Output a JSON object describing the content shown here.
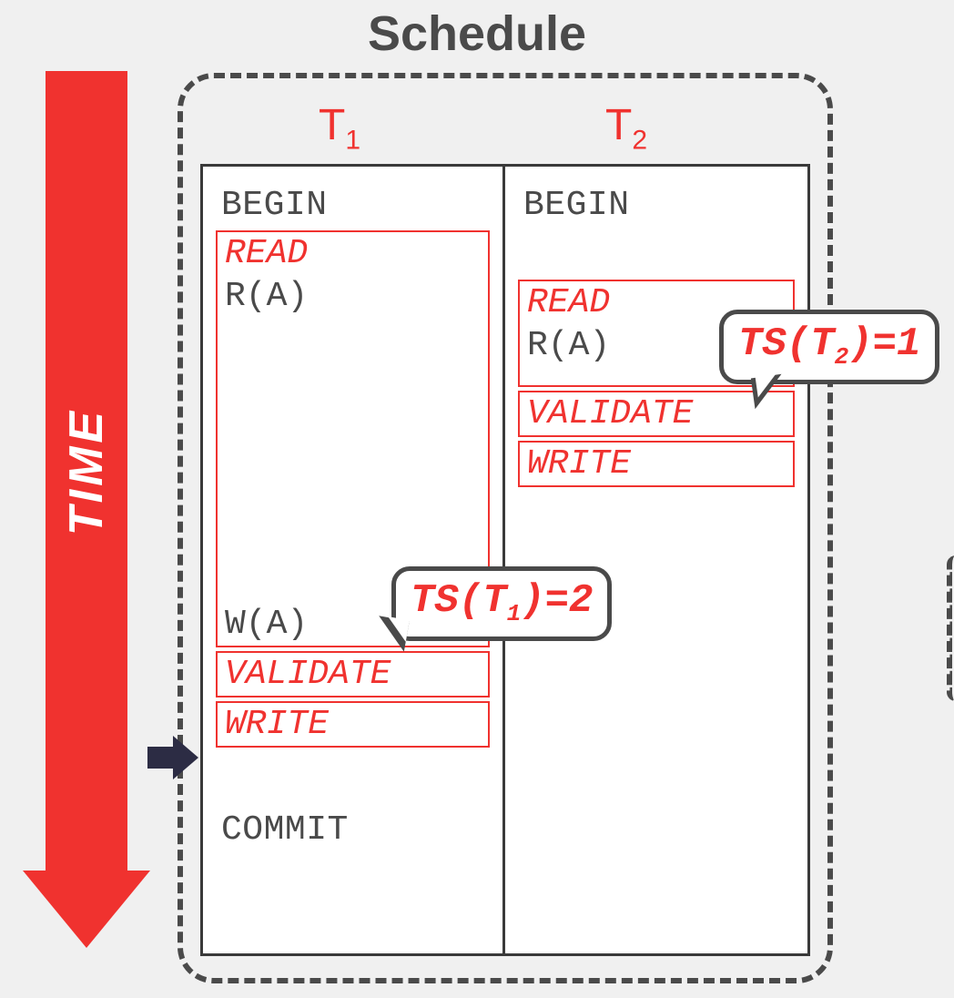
{
  "title": "Schedule",
  "time_label": "TIME",
  "columns": {
    "t1": {
      "name": "T",
      "sub": "1"
    },
    "t2": {
      "name": "T",
      "sub": "2"
    }
  },
  "ops": {
    "begin": "BEGIN",
    "read_phase": "READ",
    "validate_phase": "VALIDATE",
    "write_phase": "WRITE",
    "commit": "COMMIT",
    "ra": "R(A)",
    "wa": "W(A)"
  },
  "callouts": {
    "ts1": {
      "prefix": "TS(T",
      "sub": "1",
      "suffix": ")=2"
    },
    "ts2": {
      "prefix": "TS(T",
      "sub": "2",
      "suffix": ")=1"
    }
  },
  "colors": {
    "red": "#f0322f",
    "gray": "#4a4a4a",
    "arrow": "#2c2c44"
  }
}
